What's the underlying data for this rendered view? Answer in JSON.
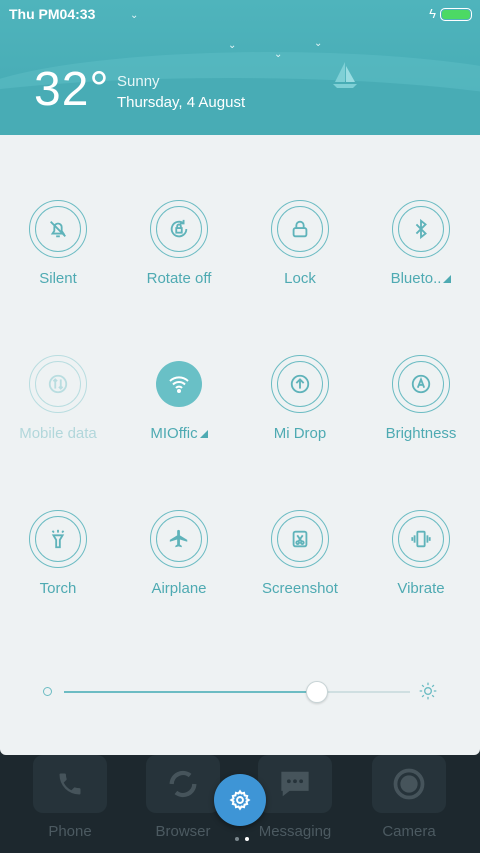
{
  "status_bar": {
    "time": "Thu PM04:33",
    "battery_color": "#4cd964"
  },
  "weather": {
    "temperature": "32°",
    "condition": "Sunny",
    "date": "Thursday, 4 August"
  },
  "toggles": [
    {
      "label": "Silent",
      "icon": "bell-off-icon",
      "state": "normal"
    },
    {
      "label": "Rotate off",
      "icon": "rotate-lock-icon",
      "state": "normal"
    },
    {
      "label": "Lock",
      "icon": "lock-icon",
      "state": "normal"
    },
    {
      "label": "Blueto..",
      "icon": "bluetooth-icon",
      "state": "normal",
      "has_submenu": true
    },
    {
      "label": "Mobile data",
      "icon": "mobile-data-icon",
      "state": "disabled"
    },
    {
      "label": "MIOffic",
      "icon": "wifi-icon",
      "state": "active",
      "has_submenu": true
    },
    {
      "label": "Mi Drop",
      "icon": "mi-drop-icon",
      "state": "normal"
    },
    {
      "label": "Brightness",
      "icon": "brightness-auto-icon",
      "state": "normal"
    },
    {
      "label": "Torch",
      "icon": "torch-icon",
      "state": "normal"
    },
    {
      "label": "Airplane",
      "icon": "airplane-icon",
      "state": "normal"
    },
    {
      "label": "Screenshot",
      "icon": "screenshot-icon",
      "state": "normal"
    },
    {
      "label": "Vibrate",
      "icon": "vibrate-icon",
      "state": "normal"
    }
  ],
  "brightness": {
    "level": 0.73,
    "accent": "#6cbcc3"
  },
  "dock": [
    {
      "label": "Phone",
      "icon": "phone-icon"
    },
    {
      "label": "Browser",
      "icon": "browser-icon"
    },
    {
      "label": "Messaging",
      "icon": "messaging-icon"
    },
    {
      "label": "Camera",
      "icon": "camera-icon"
    }
  ],
  "settings_button": {
    "icon": "gear-icon",
    "color": "#3e95d6"
  },
  "page_indicator": {
    "count": 2,
    "active": 1
  }
}
